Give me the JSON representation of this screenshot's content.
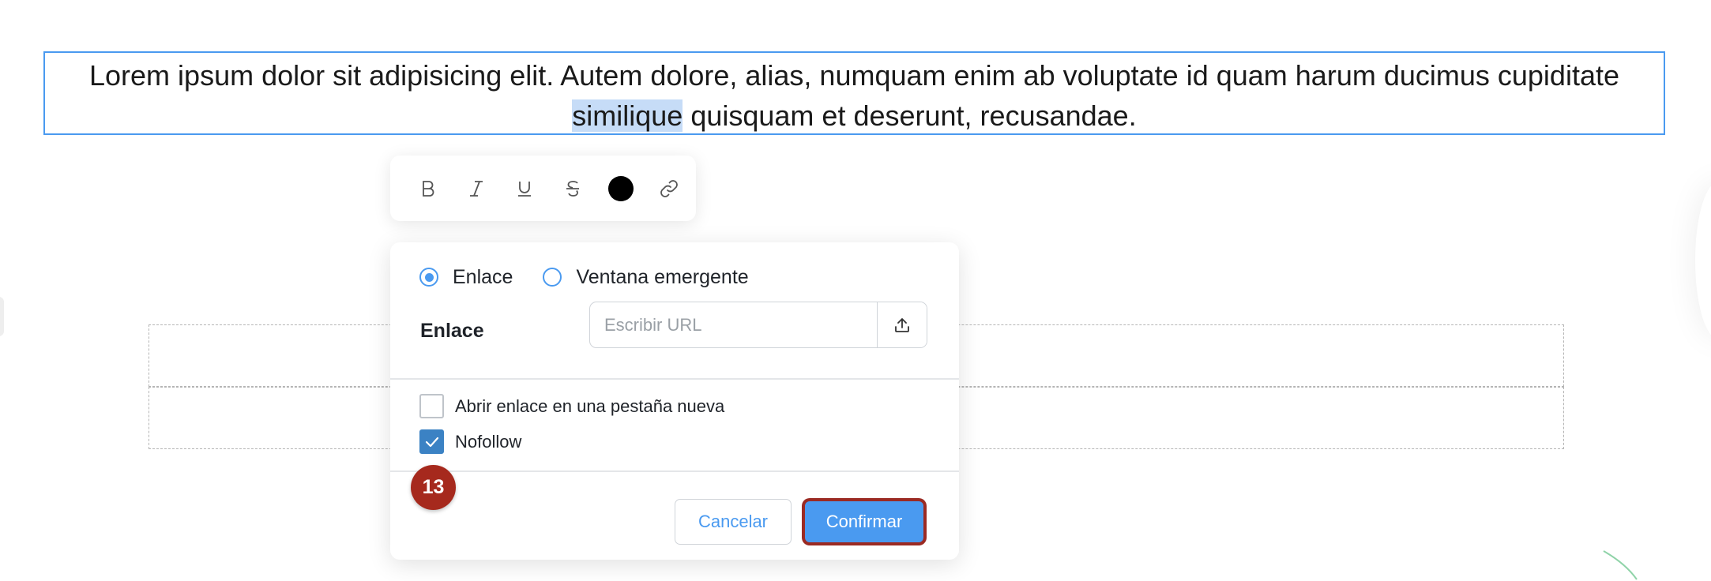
{
  "editor": {
    "text_before": "Lorem ipsum dolor sit adipisicing elit. Autem dolore, alias, numquam enim ab voluptate id quam harum ducimus cupiditate ",
    "selected_text": "similique",
    "text_after": " quisquam et deserunt, recusandae."
  },
  "toolbar": {
    "buttons": [
      "bold-icon",
      "italic-icon",
      "underline-icon",
      "strikethrough-icon",
      "color-picker",
      "link-icon"
    ],
    "text_color": "#000000"
  },
  "link_dialog": {
    "type_options": [
      {
        "label": "Enlace",
        "checked": true
      },
      {
        "label": "Ventana emergente",
        "checked": false
      }
    ],
    "url_label": "Enlace",
    "url_placeholder": "Escribir URL",
    "url_value": "",
    "options": [
      {
        "label": "Abrir enlace en una pestaña nueva",
        "checked": false
      },
      {
        "label": "Nofollow",
        "checked": true
      }
    ],
    "cancel_label": "Cancelar",
    "confirm_label": "Confirmar"
  },
  "step_badge": "13",
  "colors": {
    "accent": "#4a9af0",
    "checkbox_checked": "#3b82c4",
    "badge": "#a6291d",
    "highlight_outline": "#9b2a23",
    "selection": "#c6dcf7"
  }
}
